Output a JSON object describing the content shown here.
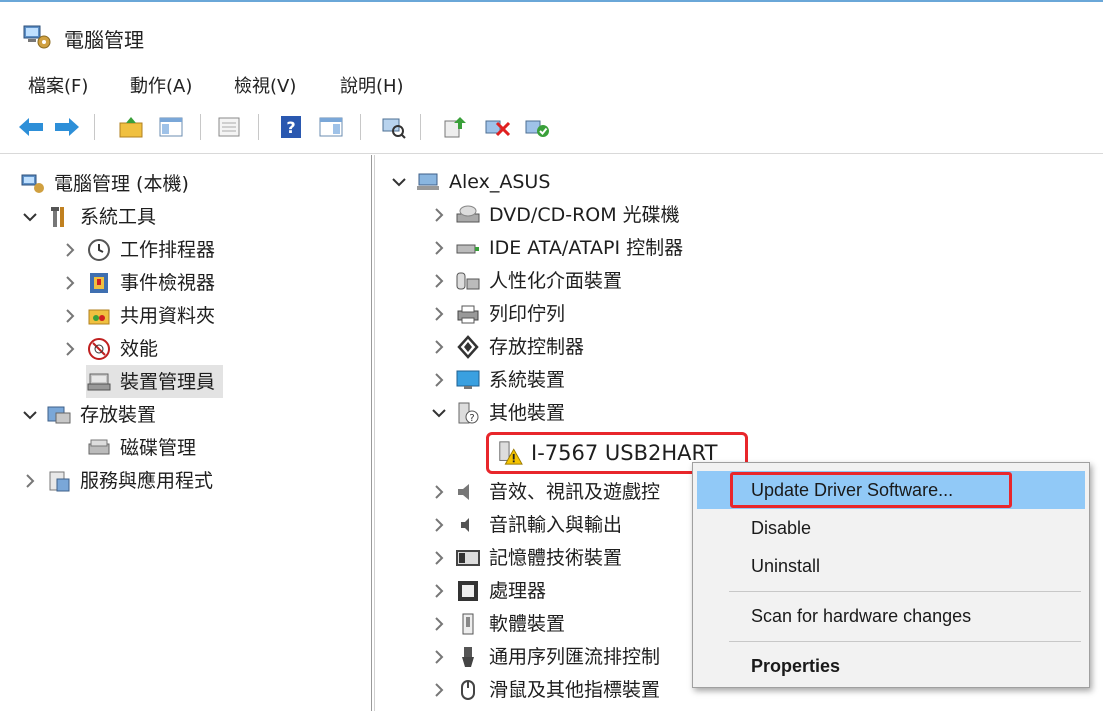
{
  "window": {
    "title": "電腦管理",
    "app_icon": "computer-management-icon"
  },
  "menu": [
    {
      "label": "檔案(F)"
    },
    {
      "label": "動作(A)"
    },
    {
      "label": "檢視(V)"
    },
    {
      "label": "說明(H)"
    }
  ],
  "toolbar": [
    {
      "icon": "back-arrow-icon"
    },
    {
      "icon": "forward-arrow-icon"
    },
    {
      "icon": "up-folder-icon"
    },
    {
      "icon": "show-hide-console-tree-icon"
    },
    {
      "icon": "properties-icon"
    },
    {
      "icon": "help-icon"
    },
    {
      "icon": "show-hide-action-pane-icon"
    },
    {
      "icon": "scan-hardware-icon"
    },
    {
      "icon": "update-driver-icon"
    },
    {
      "icon": "uninstall-device-icon"
    },
    {
      "icon": "enable-device-icon"
    }
  ],
  "left_tree": {
    "root": "電腦管理 (本機)",
    "system_tools": "系統工具",
    "task_scheduler": "工作排程器",
    "event_viewer": "事件檢視器",
    "shared_folders": "共用資料夾",
    "performance": "效能",
    "device_manager": "裝置管理員",
    "storage": "存放裝置",
    "disk_management": "磁碟管理",
    "services_apps": "服務與應用程式"
  },
  "device_tree": {
    "root": "Alex_ASUS",
    "categories": [
      {
        "label": "DVD/CD-ROM 光碟機",
        "icon": "dvd-drive-icon"
      },
      {
        "label": "IDE ATA/ATAPI 控制器",
        "icon": "ide-controller-icon"
      },
      {
        "label": "人性化介面裝置",
        "icon": "hid-device-icon"
      },
      {
        "label": "列印佇列",
        "icon": "print-queue-icon"
      },
      {
        "label": "存放控制器",
        "icon": "storage-controller-icon"
      },
      {
        "label": "系統裝置",
        "icon": "system-device-icon"
      },
      {
        "label": "其他裝置",
        "icon": "other-device-icon"
      }
    ],
    "problem_device": "I-7567 USB2HART",
    "more_categories": [
      {
        "label": "音效、視訊及遊戲控",
        "icon": "sound-icon"
      },
      {
        "label": "音訊輸入與輸出",
        "icon": "audio-io-icon"
      },
      {
        "label": "記憶體技術裝置",
        "icon": "memory-device-icon"
      },
      {
        "label": "處理器",
        "icon": "processor-icon"
      },
      {
        "label": "軟體裝置",
        "icon": "software-device-icon"
      },
      {
        "label": "通用序列匯流排控制",
        "icon": "usb-controller-icon"
      },
      {
        "label": "滑鼠及其他指標裝置",
        "icon": "mouse-icon"
      }
    ]
  },
  "context_menu": {
    "update_driver": "Update Driver Software...",
    "disable": "Disable",
    "uninstall": "Uninstall",
    "scan": "Scan for hardware changes",
    "properties": "Properties"
  },
  "colors": {
    "highlight_red": "#e8262b",
    "menu_hover": "#91c9f7"
  }
}
